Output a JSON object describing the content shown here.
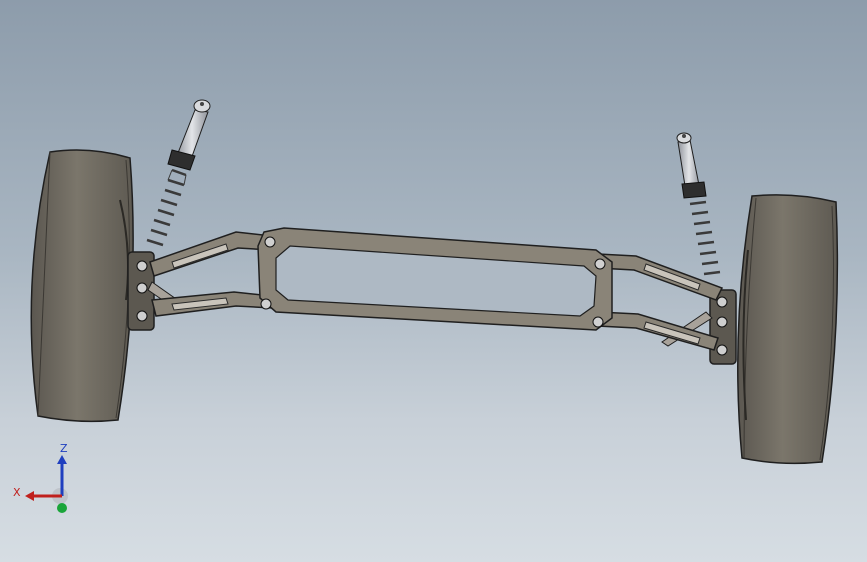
{
  "viewport": {
    "background_top": "#8d9cab",
    "background_bottom": "#d6dde3"
  },
  "model": {
    "components": [
      "tire-left",
      "tire-right",
      "shock-absorber-left",
      "shock-absorber-right",
      "coil-spring-left",
      "coil-spring-right",
      "upper-control-arm-left",
      "lower-control-arm-left",
      "upper-control-arm-right",
      "lower-control-arm-right",
      "center-frame-plate"
    ],
    "colors": {
      "tire": "#6f6a60",
      "frame": "#8a8478",
      "shock_body": "#b9bcc2",
      "spring": "#9a9a9a",
      "outline": "#1f1f1f"
    }
  },
  "triad": {
    "x_label": "X",
    "z_label": "Z",
    "x_color": "#c0201d",
    "z_color": "#1f3fbf",
    "y_color": "#1aa53a"
  }
}
